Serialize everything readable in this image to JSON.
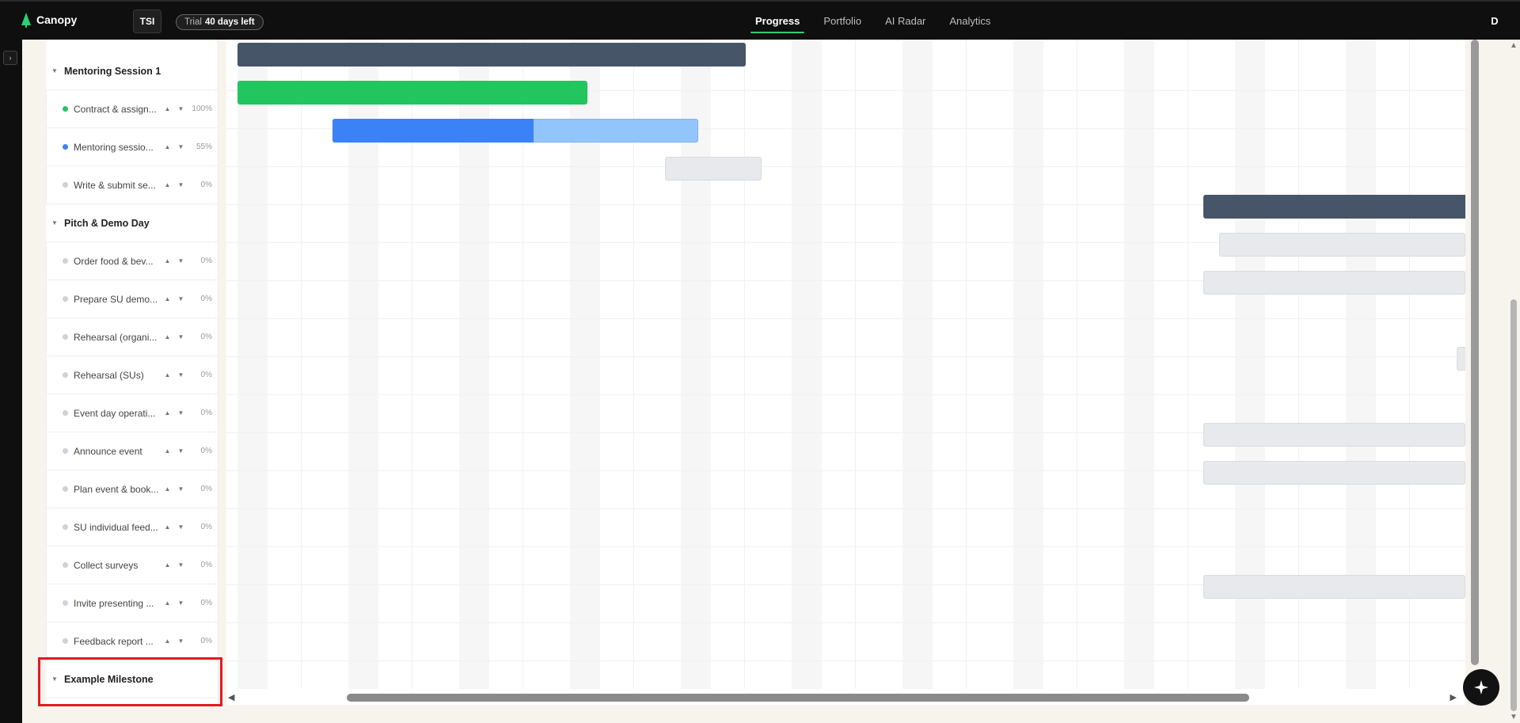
{
  "app": {
    "name": "Canopy",
    "workspace": "TSI",
    "trial_label": "Trial",
    "trial_value": "40 days left",
    "user_initial": "D"
  },
  "nav": [
    {
      "label": "Progress",
      "active": true
    },
    {
      "label": "Portfolio",
      "active": false
    },
    {
      "label": "AI Radar",
      "active": false
    },
    {
      "label": "Analytics",
      "active": false
    }
  ],
  "colors": {
    "accent": "#2ecf73",
    "done": "#22c55e",
    "progress": "#3b82f6",
    "milestone": "#475569",
    "highlight": "#e01b24"
  },
  "tasks": {
    "group1": {
      "name": "Mentoring Session 1"
    },
    "t1": {
      "name": "Contract & assign...",
      "status": "done",
      "progress": "100%"
    },
    "t2": {
      "name": "Mentoring sessio...",
      "status": "in-progress",
      "progress": "55%"
    },
    "t3": {
      "name": "Write & submit se...",
      "status": "todo",
      "progress": "0%"
    },
    "group2": {
      "name": "Pitch & Demo Day"
    },
    "t4": {
      "name": "Order food & bev...",
      "progress": "0%"
    },
    "t5": {
      "name": "Prepare SU demo...",
      "progress": "0%"
    },
    "t6": {
      "name": "Rehearsal (organi...",
      "progress": "0%"
    },
    "t7": {
      "name": "Rehearsal (SUs)",
      "progress": "0%"
    },
    "t8": {
      "name": "Event day operati...",
      "progress": "0%"
    },
    "t9": {
      "name": "Announce event",
      "progress": "0%"
    },
    "t10": {
      "name": "Plan event & book...",
      "progress": "0%"
    },
    "t11": {
      "name": "SU individual feed...",
      "progress": "0%"
    },
    "t12": {
      "name": "Collect surveys",
      "progress": "0%"
    },
    "t13": {
      "name": "Invite presenting ...",
      "progress": "0%"
    },
    "t14": {
      "name": "Feedback report ...",
      "progress": "0%"
    },
    "group3": {
      "name": "Example Milestone"
    }
  },
  "icons": {
    "collapse": "chevron-down-icon",
    "move_up": "arrow-up-icon",
    "move_down": "arrow-down-icon",
    "assistant": "sparkle-icon",
    "sidebar_toggle": "chevron-right-icon"
  }
}
